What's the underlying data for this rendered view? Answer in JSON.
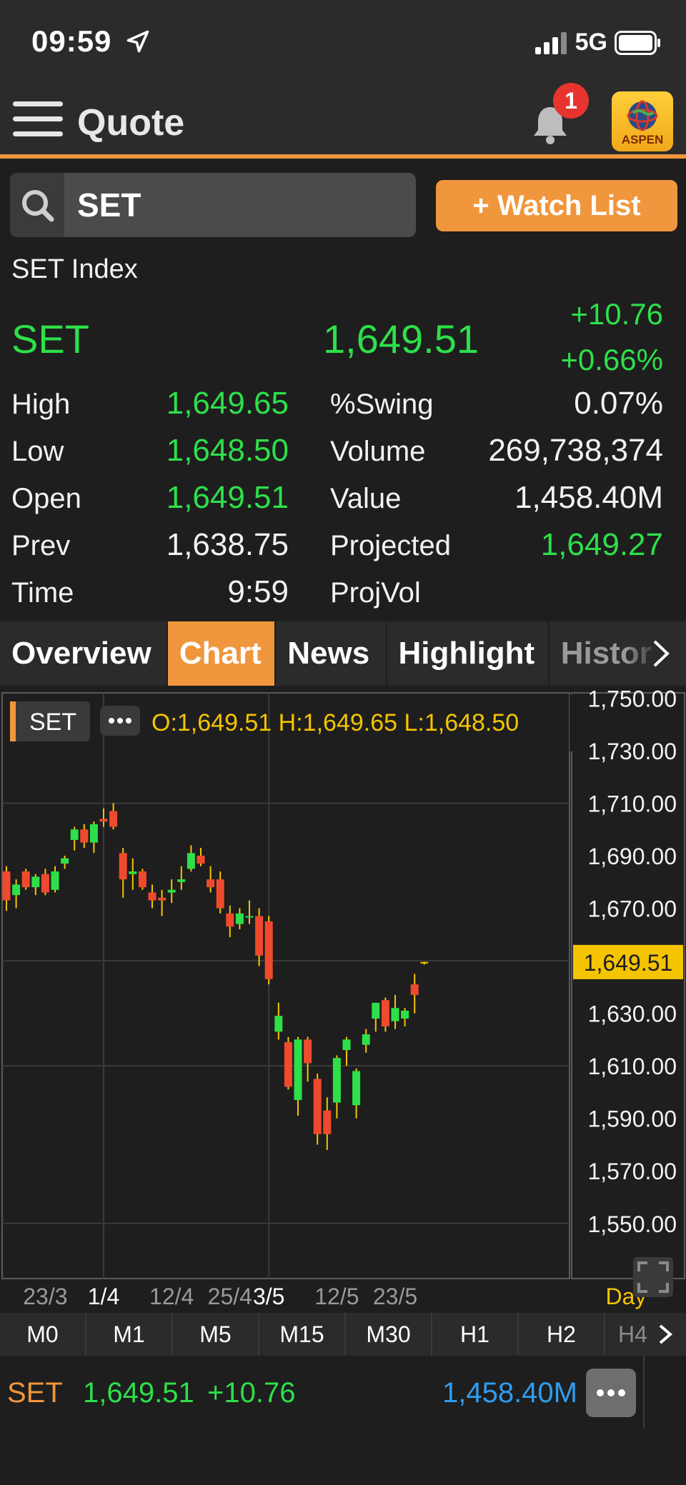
{
  "status": {
    "time": "09:59",
    "network": "5G"
  },
  "header": {
    "title": "Quote",
    "notifications": "1",
    "logo_text": "ASPEN"
  },
  "search": {
    "value": "SET",
    "watch_label": "+ Watch List"
  },
  "quote": {
    "name": "SET Index",
    "symbol": "SET",
    "last": "1,649.51",
    "change": "+10.76",
    "pct_change": "+0.66%",
    "left": [
      {
        "label": "High",
        "value": "1,649.65",
        "color": "green"
      },
      {
        "label": "Low",
        "value": "1,648.50",
        "color": "green"
      },
      {
        "label": "Open",
        "value": "1,649.51",
        "color": "green"
      },
      {
        "label": "Prev",
        "value": "1,638.75",
        "color": "white"
      },
      {
        "label": "Time",
        "value": "9:59",
        "color": "white"
      }
    ],
    "right": [
      {
        "label": "%Swing",
        "value": "0.07%",
        "color": "white"
      },
      {
        "label": "Volume",
        "value": "269,738,374",
        "color": "white"
      },
      {
        "label": "Value",
        "value": "1,458.40M",
        "color": "white"
      },
      {
        "label": "Projected",
        "value": "1,649.27",
        "color": "green"
      },
      {
        "label": "ProjVol",
        "value": "",
        "color": "white"
      }
    ]
  },
  "tabs": [
    "Overview",
    "Chart",
    "News",
    "Highlight",
    "Histor"
  ],
  "active_tab": "Chart",
  "chart_data": {
    "type": "candlestick",
    "symbol_chip": "SET",
    "ohlc_label": "O:1,649.51  H:1,649.65  L:1,648.50",
    "y_ticks": [
      "1,750.00",
      "1,730.00",
      "1,710.00",
      "1,690.00",
      "1,670.00",
      "1,630.00",
      "1,610.00",
      "1,590.00",
      "1,570.00",
      "1,550.00"
    ],
    "y_tick_values": [
      1750,
      1730,
      1710,
      1690,
      1670,
      1630,
      1610,
      1590,
      1570,
      1550
    ],
    "ylim": [
      1529,
      1752
    ],
    "price_marker": {
      "value": 1649.51,
      "label": "1,649.51"
    },
    "x_labels": [
      {
        "text": "23/3",
        "index": 4,
        "bold": false
      },
      {
        "text": "1/4",
        "index": 10,
        "bold": true
      },
      {
        "text": "12/4",
        "index": 17,
        "bold": false
      },
      {
        "text": "25/4",
        "index": 23,
        "bold": false
      },
      {
        "text": "3/5",
        "index": 27,
        "bold": true
      },
      {
        "text": "12/5",
        "index": 34,
        "bold": false
      },
      {
        "text": "23/5",
        "index": 40,
        "bold": false
      }
    ],
    "period_label": "Day",
    "candles": [
      {
        "o": 1684,
        "h": 1686,
        "l": 1669,
        "c": 1673
      },
      {
        "o": 1675,
        "h": 1681,
        "l": 1670,
        "c": 1679
      },
      {
        "o": 1684,
        "h": 1685,
        "l": 1677,
        "c": 1678
      },
      {
        "o": 1678,
        "h": 1683,
        "l": 1675,
        "c": 1682
      },
      {
        "o": 1683,
        "h": 1685,
        "l": 1675,
        "c": 1676
      },
      {
        "o": 1677,
        "h": 1686,
        "l": 1676,
        "c": 1684
      },
      {
        "o": 1687,
        "h": 1690,
        "l": 1685,
        "c": 1689
      },
      {
        "o": 1696,
        "h": 1701,
        "l": 1692,
        "c": 1700
      },
      {
        "o": 1700,
        "h": 1702,
        "l": 1693,
        "c": 1695
      },
      {
        "o": 1695,
        "h": 1703,
        "l": 1691,
        "c": 1702
      },
      {
        "o": 1704,
        "h": 1708,
        "l": 1701,
        "c": 1703
      },
      {
        "o": 1707,
        "h": 1710,
        "l": 1700,
        "c": 1701
      },
      {
        "o": 1691,
        "h": 1693,
        "l": 1674,
        "c": 1681
      },
      {
        "o": 1683,
        "h": 1689,
        "l": 1677,
        "c": 1684
      },
      {
        "o": 1684,
        "h": 1685,
        "l": 1677,
        "c": 1678
      },
      {
        "o": 1676,
        "h": 1679,
        "l": 1670,
        "c": 1673
      },
      {
        "o": 1674,
        "h": 1677,
        "l": 1667,
        "c": 1673
      },
      {
        "o": 1676,
        "h": 1681,
        "l": 1672,
        "c": 1677
      },
      {
        "o": 1680,
        "h": 1686,
        "l": 1677,
        "c": 1681
      },
      {
        "o": 1685,
        "h": 1694,
        "l": 1684,
        "c": 1691
      },
      {
        "o": 1690,
        "h": 1693,
        "l": 1686,
        "c": 1687
      },
      {
        "o": 1681,
        "h": 1686,
        "l": 1676,
        "c": 1678
      },
      {
        "o": 1681,
        "h": 1684,
        "l": 1668,
        "c": 1670
      },
      {
        "o": 1668,
        "h": 1671,
        "l": 1659,
        "c": 1663
      },
      {
        "o": 1664,
        "h": 1670,
        "l": 1662,
        "c": 1668
      },
      {
        "o": 1667,
        "h": 1673,
        "l": 1664,
        "c": 1667
      },
      {
        "o": 1667,
        "h": 1670,
        "l": 1648,
        "c": 1652
      },
      {
        "o": 1665,
        "h": 1667,
        "l": 1641,
        "c": 1643
      },
      {
        "o": 1623,
        "h": 1634,
        "l": 1620,
        "c": 1629
      },
      {
        "o": 1619,
        "h": 1621,
        "l": 1601,
        "c": 1602
      },
      {
        "o": 1597,
        "h": 1621,
        "l": 1591,
        "c": 1620
      },
      {
        "o": 1620,
        "h": 1621,
        "l": 1604,
        "c": 1611
      },
      {
        "o": 1605,
        "h": 1607,
        "l": 1580,
        "c": 1584
      },
      {
        "o": 1593,
        "h": 1598,
        "l": 1578,
        "c": 1584
      },
      {
        "o": 1596,
        "h": 1614,
        "l": 1590,
        "c": 1613
      },
      {
        "o": 1616,
        "h": 1621,
        "l": 1610,
        "c": 1620
      },
      {
        "o": 1595,
        "h": 1609,
        "l": 1590,
        "c": 1608
      },
      {
        "o": 1618,
        "h": 1624,
        "l": 1615,
        "c": 1622
      },
      {
        "o": 1628,
        "h": 1634,
        "l": 1623,
        "c": 1634
      },
      {
        "o": 1635,
        "h": 1636,
        "l": 1623,
        "c": 1625
      },
      {
        "o": 1627,
        "h": 1637,
        "l": 1624,
        "c": 1632
      },
      {
        "o": 1628,
        "h": 1632,
        "l": 1625,
        "c": 1631
      },
      {
        "o": 1641,
        "h": 1645,
        "l": 1630,
        "c": 1637
      },
      {
        "o": 1649.51,
        "h": 1649.65,
        "l": 1648.5,
        "c": 1649.51
      }
    ]
  },
  "timeframes": [
    "M0",
    "M1",
    "M5",
    "M15",
    "M30",
    "H1",
    "H2",
    "H4"
  ],
  "footer": {
    "symbol": "SET",
    "last": "1,649.51",
    "change": "+10.76",
    "value": "1,458.40M"
  },
  "colors": {
    "accent": "#f0963c",
    "up": "#2de04a",
    "down": "#f04a2e",
    "marker": "#f5c400",
    "value_blue": "#2f9df0"
  }
}
